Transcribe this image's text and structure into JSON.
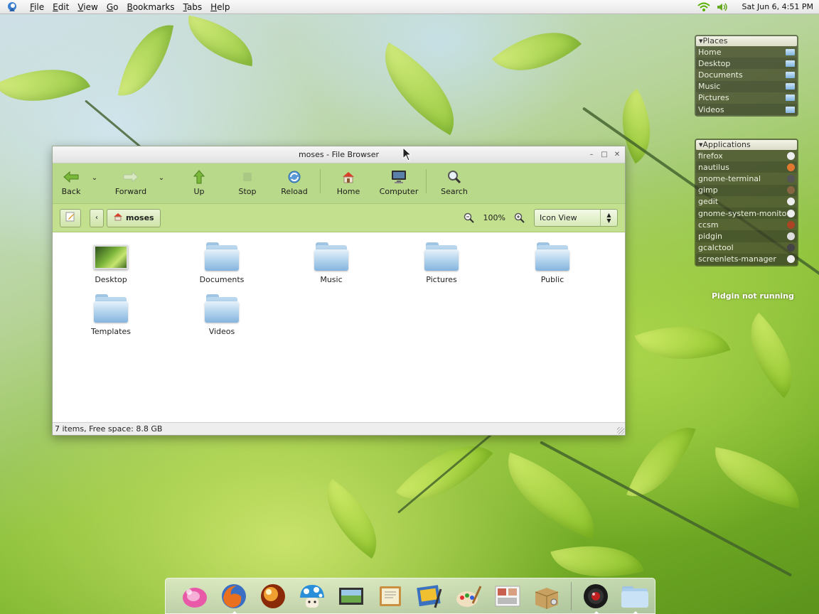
{
  "top_panel": {
    "menus": [
      {
        "label": "File",
        "accel": "F",
        "rest": "ile"
      },
      {
        "label": "Edit",
        "accel": "E",
        "rest": "dit"
      },
      {
        "label": "View",
        "accel": "V",
        "rest": "iew"
      },
      {
        "label": "Go",
        "accel": "G",
        "rest": "o"
      },
      {
        "label": "Bookmarks",
        "accel": "B",
        "rest": "ookmarks"
      },
      {
        "label": "Tabs",
        "accel": "T",
        "rest": "abs"
      },
      {
        "label": "Help",
        "accel": "H",
        "rest": "elp"
      }
    ],
    "clock": "Sat Jun  6,  4:51 PM"
  },
  "places": {
    "title": "Places",
    "items": [
      "Home",
      "Desktop",
      "Documents",
      "Music",
      "Pictures",
      "Videos"
    ]
  },
  "applications": {
    "title": "Applications",
    "items": [
      "firefox",
      "nautilus",
      "gnome-terminal",
      "gimp",
      "gedit",
      "gnome-system-monitor",
      "ccsm",
      "pidgin",
      "gcalctool",
      "screenlets-manager"
    ]
  },
  "pidgin_status": "Pidgin not running",
  "window": {
    "title": "moses - File Browser",
    "toolbar": {
      "back": "Back",
      "forward": "Forward",
      "up": "Up",
      "stop": "Stop",
      "reload": "Reload",
      "home": "Home",
      "computer": "Computer",
      "search": "Search"
    },
    "location": {
      "crumb": "moses",
      "zoom": "100%",
      "view": "Icon View"
    },
    "files": [
      {
        "name": "Desktop",
        "kind": "desktop"
      },
      {
        "name": "Documents",
        "kind": "folder"
      },
      {
        "name": "Music",
        "kind": "folder"
      },
      {
        "name": "Pictures",
        "kind": "folder"
      },
      {
        "name": "Public",
        "kind": "folder"
      },
      {
        "name": "Templates",
        "kind": "folder"
      },
      {
        "name": "Videos",
        "kind": "folder"
      }
    ],
    "status": "7 items, Free space: 8.8 GB"
  },
  "dock": {
    "items": [
      "screenlets-icon",
      "firefox-icon",
      "compiz-orb-icon",
      "mushroom-icon",
      "photo-viewer-icon",
      "notebook-icon",
      "image-editor-icon",
      "paint-palette-icon",
      "photo-booth-icon",
      "box-and-tools-icon",
      "camera-lens-icon",
      "folder-icon"
    ]
  },
  "colors": {
    "toolbar": "#b8d98a",
    "location_bar": "#c3e08f",
    "folder_blue": "#8fbbe0"
  }
}
